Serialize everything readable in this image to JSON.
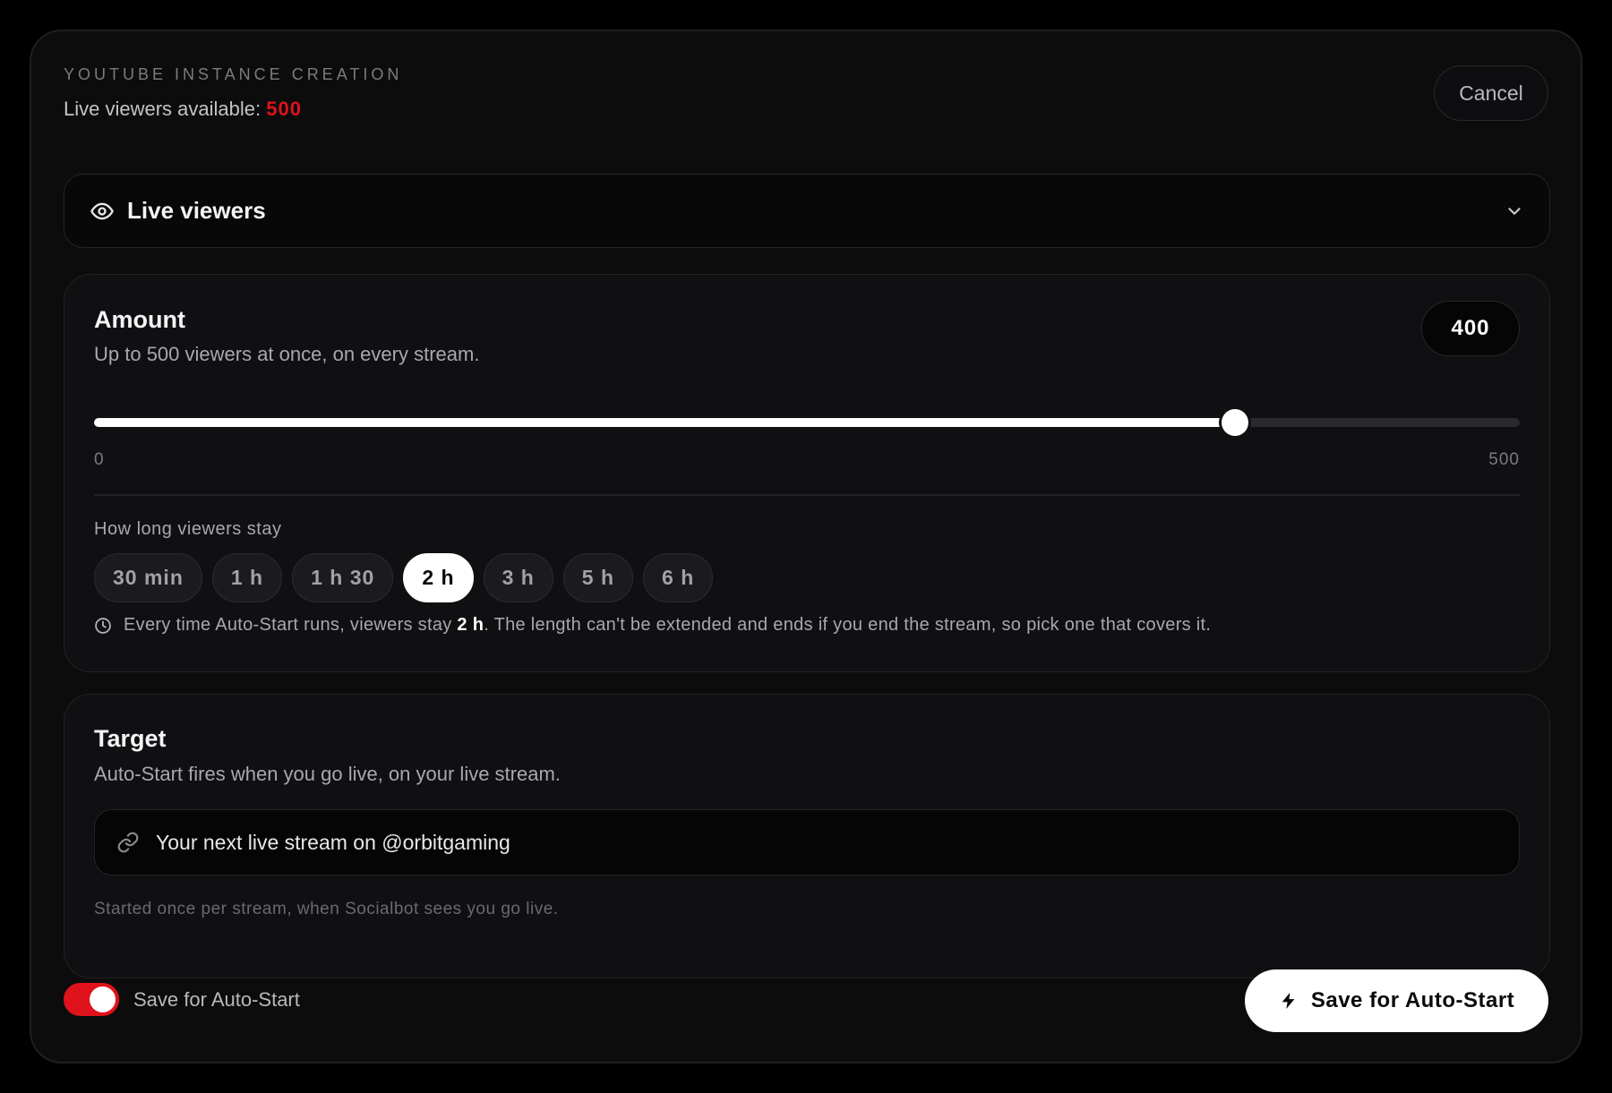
{
  "header": {
    "eyebrow": "YOUTUBE INSTANCE CREATION",
    "available_label": "Live viewers available:",
    "available_value": "500",
    "cancel_label": "Cancel"
  },
  "service_select": {
    "icon": "eye-icon",
    "selected": "Live viewers"
  },
  "amount": {
    "title": "Amount",
    "subtitle": "Up to 500 viewers at once, on every stream.",
    "value": "400",
    "slider": {
      "min": 0,
      "max": 500,
      "value": 400,
      "min_label": "0",
      "max_label": "500"
    }
  },
  "duration": {
    "label": "How long viewers stay",
    "options": [
      "30 min",
      "1 h",
      "1 h 30",
      "2 h",
      "3 h",
      "5 h",
      "6 h"
    ],
    "selected_index": 3,
    "note_before": "Every time Auto-Start runs, viewers stay ",
    "note_value": "2 h",
    "note_after": ". The length can't be extended and ends if you end the stream, so pick one that covers it."
  },
  "target": {
    "title": "Target",
    "subtitle": "Auto-Start fires when you go live, on your live stream.",
    "input_value": "Your next live stream on @orbitgaming",
    "footnote": "Started once per stream, when Socialbot sees you go live."
  },
  "footer": {
    "toggle_on": true,
    "toggle_label": "Save for Auto-Start",
    "save_label": "Save for Auto-Start"
  },
  "colors": {
    "accent": "#e0121b",
    "background": "#000000",
    "surface": "#0c0c0d",
    "card": "#101012"
  }
}
